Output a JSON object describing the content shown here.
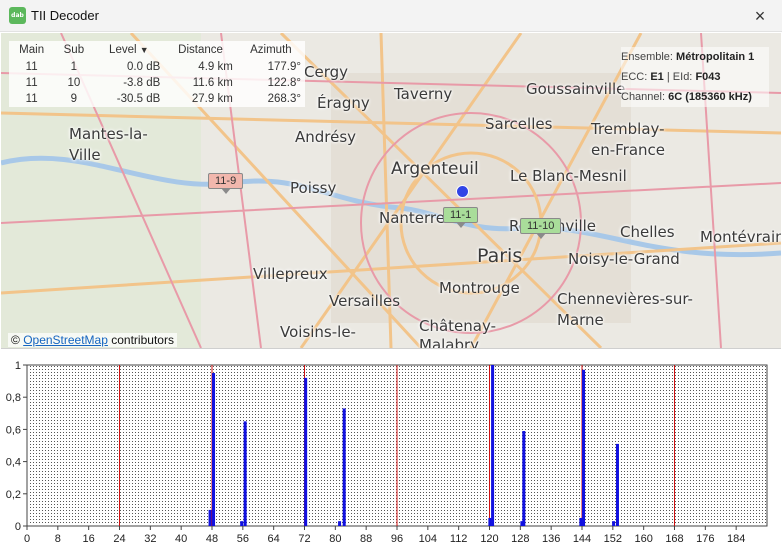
{
  "window": {
    "title": "TII Decoder",
    "icon_text": "dab",
    "close_icon": "×"
  },
  "map": {
    "places": [
      {
        "name": "Cergy",
        "size": "m"
      },
      {
        "name": "Taverny",
        "size": "m"
      },
      {
        "name": "Goussainville",
        "size": "m"
      },
      {
        "name": "Éragny",
        "size": "m"
      },
      {
        "name": "Sarcelles",
        "size": "m"
      },
      {
        "name": "Tremblay-en-France",
        "size": "m"
      },
      {
        "name": "Mantes-la-Ville",
        "size": "m"
      },
      {
        "name": "Andrésy",
        "size": "m"
      },
      {
        "name": "Argenteuil",
        "size": "l"
      },
      {
        "name": "Le Blanc-Mesnil",
        "size": "m"
      },
      {
        "name": "Poissy",
        "size": "m"
      },
      {
        "name": "Nanterre",
        "size": "m"
      },
      {
        "name": "Romainville",
        "size": "m"
      },
      {
        "name": "Chelles",
        "size": "m"
      },
      {
        "name": "Montévrain",
        "size": "m"
      },
      {
        "name": "Paris",
        "size": "xl"
      },
      {
        "name": "Noisy-le-Grand",
        "size": "m"
      },
      {
        "name": "Villepreux",
        "size": "m"
      },
      {
        "name": "Montrouge",
        "size": "m"
      },
      {
        "name": "Versailles",
        "size": "m"
      },
      {
        "name": "Chennevières-sur-Marne",
        "size": "m"
      },
      {
        "name": "Voisins-le-",
        "size": "m"
      },
      {
        "name": "Châtenay-Malabry",
        "size": "m"
      }
    ],
    "markers": [
      {
        "label": "11-9",
        "color": "red"
      },
      {
        "label": "11-1",
        "color": "green"
      },
      {
        "label": "11-10",
        "color": "green"
      }
    ],
    "attribution": {
      "prefix": "©",
      "link": "OpenStreetMap",
      "suffix": "contributors"
    }
  },
  "table": {
    "headers": {
      "main": "Main",
      "sub": "Sub",
      "level": "Level",
      "distance": "Distance",
      "azimuth": "Azimuth"
    },
    "rows": [
      {
        "main": "11",
        "sub": "1",
        "level": "0.0 dB",
        "distance": "4.9 km",
        "azimuth": "177.9°"
      },
      {
        "main": "11",
        "sub": "10",
        "level": "-3.8 dB",
        "distance": "11.6 km",
        "azimuth": "122.8°"
      },
      {
        "main": "11",
        "sub": "9",
        "level": "-30.5 dB",
        "distance": "27.9 km",
        "azimuth": "268.3°"
      }
    ]
  },
  "info": {
    "ensemble_label": "Ensemble:",
    "ensemble_value": "Métropolitain 1",
    "ecc_label": "ECC:",
    "ecc_value": "E1",
    "eid_label": "EId:",
    "eid_value": "F043",
    "channel_label": "Channel:",
    "channel_value": "6C (185360 kHz)"
  },
  "chart_data": {
    "type": "bar",
    "x_ticks": [
      0,
      8,
      16,
      24,
      32,
      40,
      48,
      56,
      64,
      72,
      80,
      88,
      96,
      104,
      112,
      120,
      128,
      136,
      144,
      152,
      160,
      168,
      176,
      184
    ],
    "y_ticks": [
      "0",
      "0,2",
      "0,4",
      "0,6",
      "0,8",
      "1"
    ],
    "xlim": [
      0,
      192
    ],
    "ylim": [
      0,
      1
    ],
    "red_lines_x": [
      24,
      48,
      72,
      96,
      120,
      144,
      168
    ],
    "series": [
      {
        "x": [
          47.5,
          48.4,
          55.7,
          56.6,
          72.3,
          81.1,
          82.3,
          120.1,
          120.8,
          128.4,
          128.9,
          143.7,
          144.4,
          152.2,
          153.2
        ],
        "values": [
          0.1,
          0.95,
          0.03,
          0.65,
          0.92,
          0.03,
          0.73,
          0.05,
          1.0,
          0.03,
          0.59,
          0.05,
          0.97,
          0.03,
          0.51
        ]
      }
    ],
    "colors": {
      "bar": "#1010e0",
      "grid_line": "#d01010"
    }
  }
}
